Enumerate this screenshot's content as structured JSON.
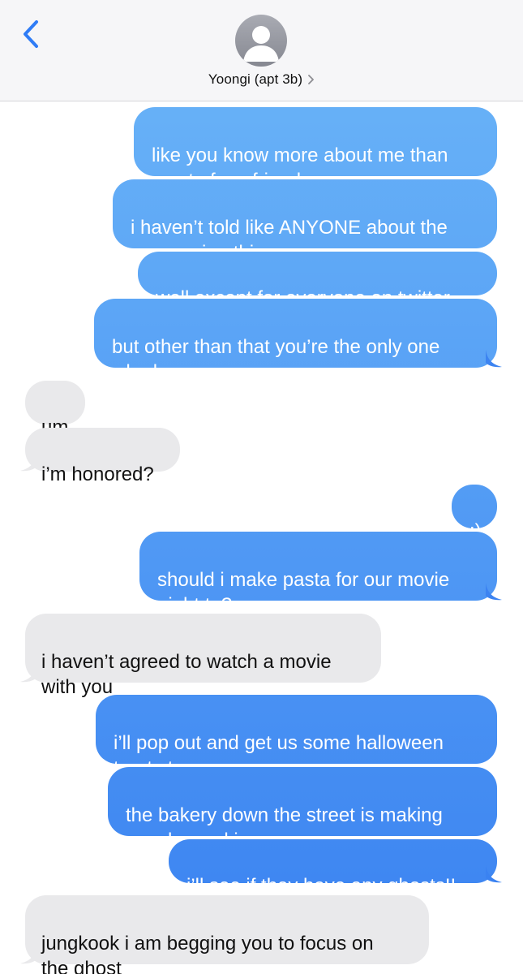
{
  "header": {
    "contact_name": "Yoongi (apt 3b)"
  },
  "colors": {
    "sent_top": "#6cb6f8",
    "sent_bottom": "#3a82f1",
    "received": "#e9e9eb",
    "back_chevron": "#2f7cf6",
    "header_bg": "#f6f6f8"
  },
  "icons": {
    "back": "chevron-left-icon",
    "avatar": "person-silhouette-icon",
    "name_chevron": "chevron-right-icon"
  },
  "messages": [
    {
      "from": "me",
      "text": "like you know more about me than\nmost of my friends"
    },
    {
      "from": "me",
      "text": "i haven’t told like ANYONE about the\npossession thing"
    },
    {
      "from": "me",
      "text": "well except for everyone on twitter"
    },
    {
      "from": "me",
      "text": "but other than that you’re the only one\nwho knows"
    },
    {
      "from": "them",
      "text": "um"
    },
    {
      "from": "them",
      "text": "i’m honored?"
    },
    {
      "from": "me",
      "text": ":)"
    },
    {
      "from": "me",
      "text": "should i make pasta for our movie\nnight tn?"
    },
    {
      "from": "them",
      "text": "i haven’t agreed to watch a movie\nwith you"
    },
    {
      "from": "me",
      "text": "i’ll pop out and get us some halloween\ntreats too"
    },
    {
      "from": "me",
      "text": "the bakery down the street is making\nspooky cookies"
    },
    {
      "from": "me",
      "text": "i’ll see if they have any ghosts!!"
    },
    {
      "from": "them",
      "text": "jungkook i am begging you to focus on\nthe ghost"
    }
  ]
}
